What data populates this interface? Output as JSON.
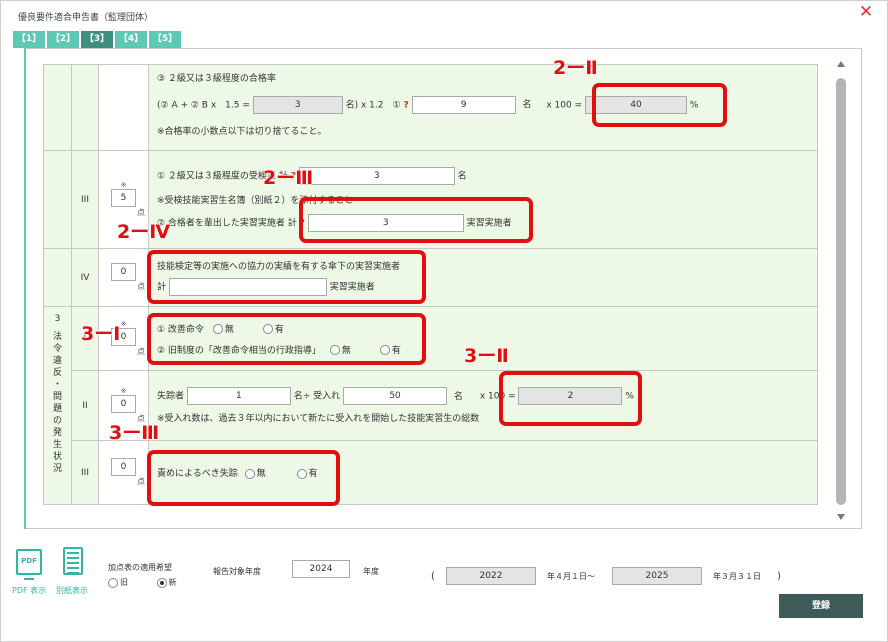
{
  "window": {
    "title": "優良要件適合申告書（監理団体）",
    "close_symbol": "✕"
  },
  "tabs": [
    "【1】",
    "【2】",
    "【3】",
    "【4】",
    "【5】"
  ],
  "active_tab": 2,
  "rows": {
    "r1": {
      "line1": "③ ２級又は３級程度の合格率",
      "prefix": "(② A + ② B x　1.5 =",
      "val_ab": "3",
      "mid": "名) x 1.2　①",
      "q": "?",
      "val_1": "9",
      "unit_1": "名",
      "x100": "x 100 =",
      "rate": "40",
      "pct": "%",
      "note": "※合格率の小数点以下は切り捨てること。"
    },
    "r2": {
      "num": "III",
      "asterisk": "※",
      "points": "5",
      "pt": "点",
      "line1": "① ２級又は３級程度の受検",
      "line1b": "者 計",
      "q": "?",
      "val": "3",
      "unit": "名",
      "note": "※受検技能実習生名簿（別紙２）を添付すること",
      "line2": "② 合格者を輩出した実習実施者 計",
      "q2": "?",
      "val2": "3",
      "unit2": "実習実施者"
    },
    "r3": {
      "num": "IV",
      "points": "0",
      "pt": "点",
      "line1": "技能検定等の実施への協力の実績を有する傘下の実習実施者",
      "kei": "計",
      "val": "",
      "unit": "実習実施者"
    },
    "r4": {
      "cat": [
        "3",
        "法",
        "令",
        "違",
        "反",
        "・",
        "問",
        "題",
        "の",
        "発",
        "生",
        "状",
        "況"
      ],
      "num": "I",
      "asterisk": "※",
      "points": "0",
      "pt": "点",
      "line1": "① 改善命令",
      "opt_no": "無",
      "opt_yes": "有",
      "line2": "② 旧制度の「改善命令相当の行政指導」",
      "opt2_no": "無",
      "opt2_yes": "有"
    },
    "r5": {
      "num": "II",
      "asterisk": "※",
      "points": "0",
      "pt": "点",
      "label1": "失踪者",
      "val1": "1",
      "mid": "名÷ 受入れ",
      "val2": "50",
      "unit2": "名",
      "x100": "x 100 =",
      "rate": "2",
      "pct": "%",
      "note": "※受入れ数は、過去３年以内において新たに受入れを開始した技能実習生の総数"
    },
    "r6": {
      "num": "III",
      "points": "0",
      "pt": "点",
      "label": "責めによるべき失踪",
      "opt_no": "無",
      "opt_yes": "有"
    }
  },
  "callouts": [
    "2ーⅡ",
    "2ーⅢ",
    "2ーⅣ",
    "3ーⅠ",
    "3ーⅡ",
    "3ーⅢ"
  ],
  "footer": {
    "pdf_icon_text": "PDF",
    "pdf_label": "PDF 表示",
    "sheet_label": "別紙表示",
    "kasan_label": "加点表の適用希望",
    "opt_old": "旧",
    "opt_new": "新",
    "year_label": "報告対象年度",
    "year_val": "2024",
    "year_unit": "年度",
    "paren_open": "(",
    "from_year": "2022",
    "from_suffix": "年４月１日～",
    "to_year": "2025",
    "to_suffix": "年３月３１日",
    "paren_close": ")",
    "submit": "登録"
  },
  "colors": {
    "tab": "#5cc8b5",
    "tab_active": "#3e8f80",
    "callout": "#e01010",
    "row_bg": "#eef8e6",
    "submit": "#3e5b5a"
  }
}
